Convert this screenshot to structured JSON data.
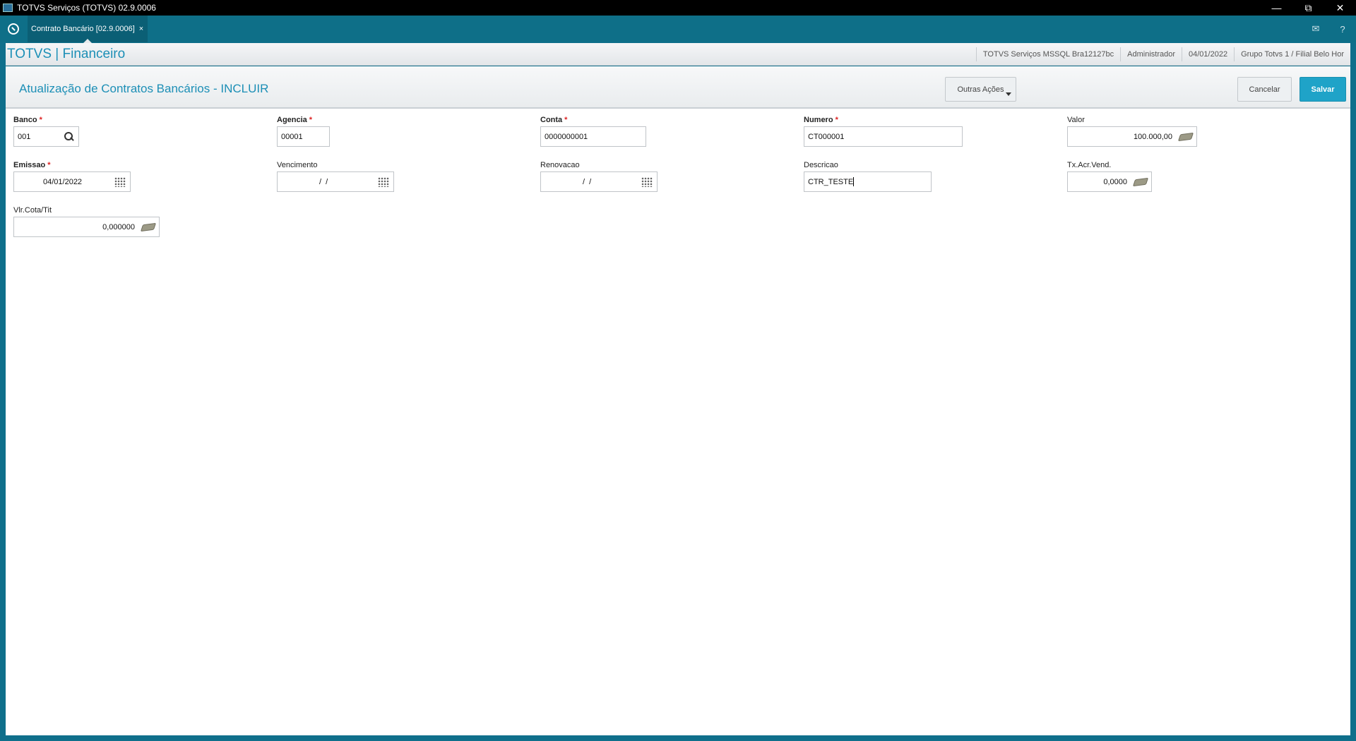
{
  "window": {
    "title": "TOTVS Serviços (TOTVS) 02.9.0006"
  },
  "tab": {
    "label": "Contrato Bancário [02.9.0006]",
    "close": "×"
  },
  "header": {
    "brand": "TOTVS | Financeiro",
    "server": "TOTVS Serviços MSSQL Bra12127bc",
    "user": "Administrador",
    "date": "04/01/2022",
    "branch": "Grupo Totvs 1 / Filial Belo Hor"
  },
  "page": {
    "title": "Atualização de Contratos Bancários - INCLUIR",
    "actions": {
      "more": "Outras Ações",
      "cancel": "Cancelar",
      "save": "Salvar"
    }
  },
  "form": {
    "banco": {
      "label": "Banco",
      "value": "001",
      "required": true
    },
    "agencia": {
      "label": "Agencia",
      "value": "00001",
      "required": true
    },
    "conta": {
      "label": "Conta",
      "value": "0000000001",
      "required": true
    },
    "numero": {
      "label": "Numero",
      "value": "CT000001",
      "required": true
    },
    "valor": {
      "label": "Valor",
      "value": "100.000,00"
    },
    "emissao": {
      "label": "Emissao",
      "value": "04/01/2022",
      "required": true
    },
    "vencimento": {
      "label": "Vencimento",
      "value": "/  /"
    },
    "renovacao": {
      "label": "Renovacao",
      "value": "/  /"
    },
    "descricao": {
      "label": "Descricao",
      "value": "CTR_TESTE"
    },
    "txacr": {
      "label": "Tx.Acr.Vend.",
      "value": "0,0000"
    },
    "vlrcota": {
      "label": "Vlr.Cota/Tit",
      "value": "0,000000"
    }
  },
  "required_mark": "*"
}
